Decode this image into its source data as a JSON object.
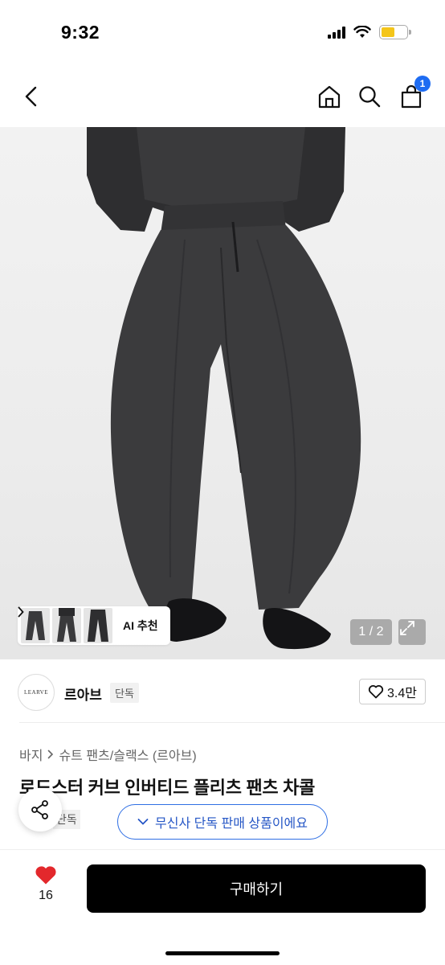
{
  "status_bar": {
    "time": "9:32"
  },
  "header": {
    "cart_count": "1"
  },
  "gallery": {
    "ai_label": "AI 추천",
    "page_indicator": "1 / 2"
  },
  "brand": {
    "logo_text": "LEARVE",
    "name": "르아브",
    "badge": "단독",
    "likes": "3.4만"
  },
  "breadcrumb": {
    "level1": "바지",
    "level2": "슈트 팬츠/슬랙스 (르아브)"
  },
  "product": {
    "title": "로드스터 커브 인버티드 플리츠 팬츠 차콜",
    "sub_tag": "단독"
  },
  "toast": {
    "text": "무신사 단독 판매 상품이에요"
  },
  "bottom": {
    "wish_count": "16",
    "buy_label": "구매하기"
  },
  "colors": {
    "accent_blue": "#2f6fe4",
    "badge_blue": "#1e6cf2",
    "heart_red": "#e3282c",
    "buy_bg": "#000000"
  }
}
